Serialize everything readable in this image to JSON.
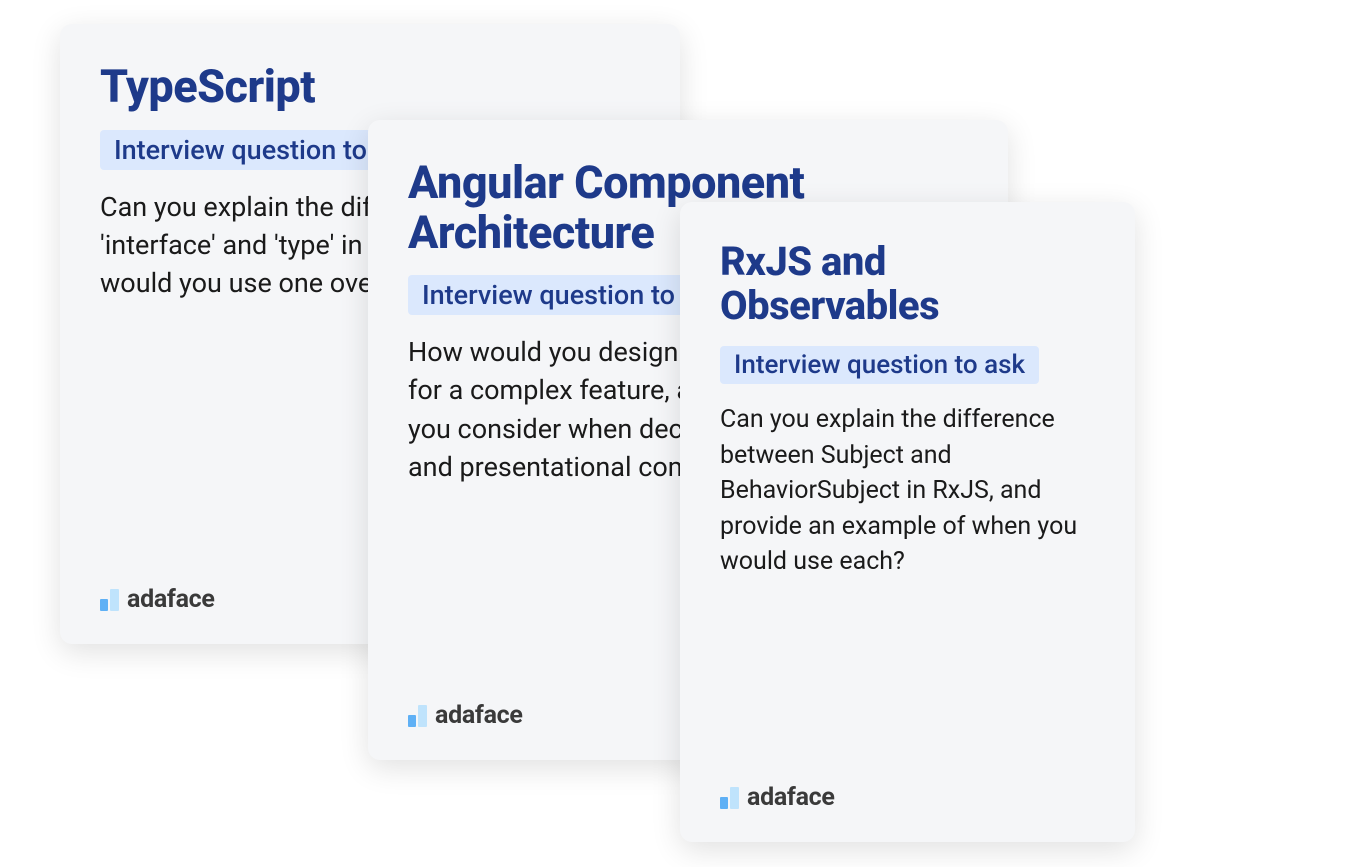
{
  "cards": [
    {
      "title": "TypeScript",
      "badge": "Interview question to ask",
      "body": "Can you explain the difference between 'interface' and 'type' in TypeScript, and when would you use one over the other?"
    },
    {
      "title": "Angular Component Architecture",
      "badge": "Interview question to ask",
      "body": "How would you design a component hierarchy for a complex feature, and what factors would you consider when deciding between smart and presentational components?"
    },
    {
      "title": "RxJS and Observables",
      "badge": "Interview question to ask",
      "body": "Can you explain the difference between Subject and BehaviorSubject in RxJS, and provide an example of when you would use each?"
    }
  ],
  "brand": "adaface"
}
